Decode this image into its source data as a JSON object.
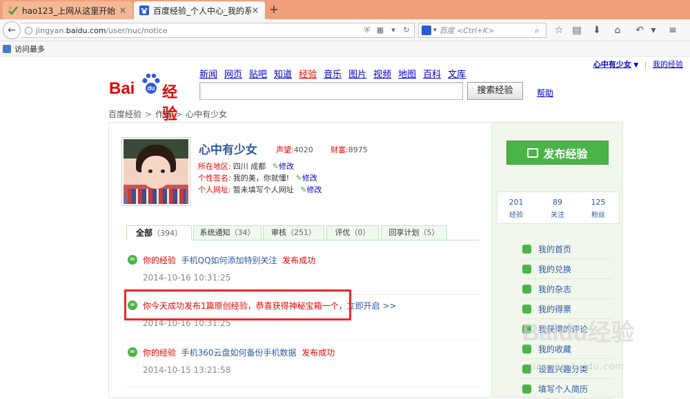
{
  "browser": {
    "tabs": [
      {
        "title": "hao123_上网从这里开始",
        "close": "×"
      },
      {
        "title": "百度经验_个人中心_我的系...",
        "close": "×"
      }
    ],
    "new_tab": "+",
    "back": "←",
    "url_prefix": "jingyan.",
    "url_host": "baidu.com",
    "url_path": "/user/nuc/notice",
    "search_placeholder": "百度 <Ctrl+K>",
    "bookmark": "访问最多"
  },
  "header": {
    "logo_bai": "Bai",
    "logo_du": "du",
    "logo_jy": "经验",
    "nav": [
      "新闻",
      "网页",
      "贴吧",
      "知道",
      "经验",
      "音乐",
      "图片",
      "视频",
      "地图",
      "百科",
      "文库"
    ],
    "nav_current": "经验",
    "user": "心中有少女",
    "user_caret": "▼",
    "sep": "|",
    "my_exp": "我的经验",
    "search_button": "搜索经验",
    "help": "帮助"
  },
  "breadcrumb": {
    "items": [
      "百度经验",
      "作者",
      "心中有少女"
    ],
    "sep": ">"
  },
  "profile": {
    "name": "心中有少女",
    "reputation_label": "声望:",
    "reputation": "4020",
    "wealth_label": "财富:",
    "wealth": "8975",
    "location_label": "所在地区:",
    "location": "四川 成都",
    "signature_label": "个性签名:",
    "signature": "我的美，你就懂!",
    "website_label": "个人网址:",
    "website": "暂未填写个人网址",
    "edit": "修改"
  },
  "tabs": [
    {
      "label": "全部",
      "count": "（394）"
    },
    {
      "label": "系统通知",
      "count": "（34）"
    },
    {
      "label": "审核",
      "count": "（251）"
    },
    {
      "label": "评优",
      "count": "（0）"
    },
    {
      "label": "回享计划",
      "count": "（5）"
    }
  ],
  "notices": [
    {
      "prefix": "你的经验",
      "link": "手机QQ如何添加特别关注",
      "suffix": "发布成功",
      "time": "2014-10-16 10:31:25"
    },
    {
      "prefix": "你今天成功发布1篇原创经验，恭喜获得神秘宝箱一个，",
      "link": "立即开启 >>",
      "suffix": "",
      "time": "2014-10-16 10:31:25"
    },
    {
      "prefix": "你的经验",
      "link": "手机360云盘如何备份手机数据",
      "suffix": "发布成功",
      "time": "2014-10-15 13:21:58"
    }
  ],
  "sidebar": {
    "publish": "发布经验",
    "stats": [
      {
        "num": "201",
        "label": "经验"
      },
      {
        "num": "89",
        "label": "关注"
      },
      {
        "num": "125",
        "label": "粉丝"
      }
    ],
    "nav": [
      "我的首页",
      "我的兑换",
      "我的杂志",
      "我的得票",
      "我获得的评论",
      "我的收藏",
      "设置兴趣分类",
      "填写个人简历"
    ]
  },
  "watermark": {
    "main": "Baidu经验",
    "sub": "jingyan.baidu.com"
  },
  "colors": {
    "accent_red": "#e10602",
    "brand_green": "#4bb448",
    "link_blue": "#2c5aa0",
    "highlight_box": "#f0262a"
  }
}
